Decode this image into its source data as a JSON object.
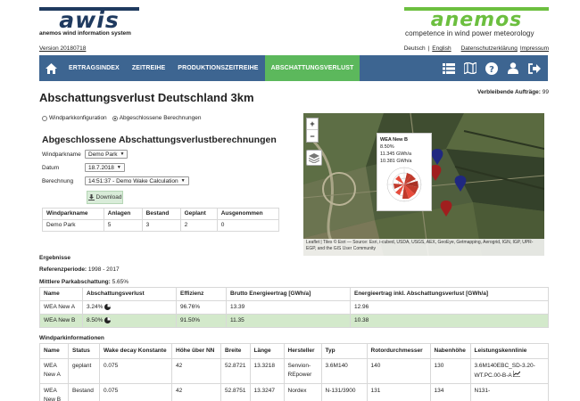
{
  "header": {
    "awis_logo_text": "awis",
    "awis_tagline": "anemos wind information system",
    "anemos_logo_text": "anemos",
    "anemos_tagline": "competence in wind power meteorology",
    "version": "Version 20180718",
    "lang_de": "Deutsch",
    "lang_sep": "|",
    "lang_en": "English",
    "privacy": "Datenschutzerklärung",
    "imprint": "Impressum"
  },
  "nav": {
    "items": [
      "ERTRAGSINDEX",
      "ZEITREIHE",
      "PRODUKTIONSZEITREIHE",
      "ABSCHATTUNGSVERLUST"
    ],
    "active_index": 3,
    "colors": {
      "bar": "#3d6591",
      "active": "#5cb85c"
    }
  },
  "page": {
    "title": "Abschattungsverlust Deutschland 3km",
    "remaining_label": "Verbleibende Aufträge:",
    "remaining_value": "99"
  },
  "radios": {
    "option1": "Windparkkonfiguration",
    "option2": "Abgeschlossene Berechnungen",
    "selected": 2
  },
  "form": {
    "section_title": "Abgeschlossene Abschattungsverlustberechnungen",
    "windpark_label": "Windparkname",
    "windpark_value": "Demo Park",
    "date_label": "Datum",
    "date_value": "18.7.2018",
    "calc_label": "Berechnung",
    "calc_value": "14:51:37 - Demo Wake Calculation",
    "download_label": "Download"
  },
  "park_table": {
    "headers": [
      "Windparkname",
      "Anlagen",
      "Bestand",
      "Geplant",
      "Ausgenommen"
    ],
    "row": [
      "Demo Park",
      "5",
      "3",
      "2",
      "0"
    ]
  },
  "map": {
    "zoom_in": "+",
    "zoom_out": "−",
    "popup_title": "WEA New B",
    "popup_line1": "8.50%",
    "popup_line2": "11.345 GWh/a",
    "popup_line3": "10.381 GWh/a",
    "attribution": "Leaflet | Tiles © Esri — Source: Esri, i-cubed, USDA, USGS, AEX, GeoEye, Getmapping, Aerogrid, IGN, IGP, UPR-EGP, and the GIS User Community"
  },
  "results": {
    "title": "Ergebnisse",
    "ref_label": "Referenzperiode:",
    "ref_value": "1998 - 2017",
    "avg_label": "Mittlere Parkabschattung:",
    "avg_value": "5.65%",
    "headers": [
      "Name",
      "Abschattungsverlust",
      "Effizienz",
      "Brutto Energieertrag [GWh/a]",
      "Energieertrag inkl. Abschattungsverlust [GWh/a]"
    ],
    "rows": [
      [
        "WEA New A",
        "3.24%",
        "96.76%",
        "13.39",
        "12.96"
      ],
      [
        "WEA New B",
        "8.50%",
        "91.50%",
        "11.35",
        "10.38"
      ]
    ],
    "highlight_color": "#d3e9cb"
  },
  "windpark_info": {
    "title": "Windparkinformationen",
    "headers": [
      "Name",
      "Status",
      "Wake decay Konstante",
      "Höhe über NN",
      "Breite",
      "Länge",
      "Hersteller",
      "Typ",
      "Rotordurchmesser",
      "Nabenhöhe",
      "Leistungskennlinie"
    ],
    "rows": [
      [
        "WEA New A",
        "geplant",
        "0.075",
        "42",
        "52.8721",
        "13.3218",
        "Senvion-REpower",
        "3.6M140",
        "140",
        "130",
        "3.6M140EBC_SD-3.20-WT.PC.00-B-A"
      ],
      [
        "WEA New B",
        "Bestand",
        "0.075",
        "42",
        "52.8751",
        "13.3247",
        "Nordex",
        "N-131/3900",
        "131",
        "134",
        "N131-"
      ]
    ]
  }
}
